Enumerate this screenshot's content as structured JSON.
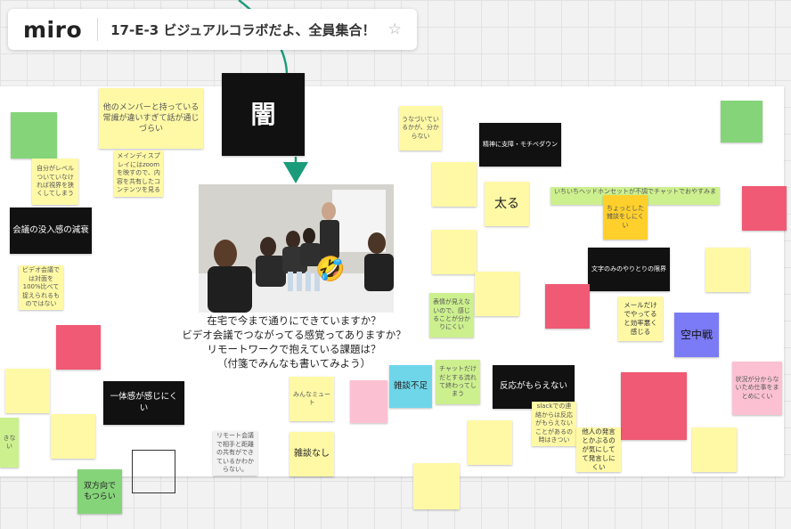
{
  "header": {
    "logo": "miro",
    "board_title": "17-E-3 ビジュアルコラボだよ、全員集合！",
    "star_icon": "☆"
  },
  "center": {
    "dark_label": "闇",
    "emoji": "🤣",
    "prompt_lines": [
      "在宅で今まで通りにできていますか？",
      "ビデオ会議でつながってる感覚ってありますか？",
      "リモートワークで抱えている課題は？",
      "（付箋でみんなも書いてみよう）"
    ]
  },
  "notes": {
    "members_pace": "他のメンバーと持っている常識が違いすぎて話が通じづらい",
    "own_level": "自分がレベルついていなければ視界を狭くしてしまう",
    "meeting_immersion": "会議の没入感の減衰",
    "media_display": "メインディスプレイにはzoomを映すので、内容を共有したコンテンツを見る",
    "video_participation": "ビデオ会議では対面を100%比べて捉えられるものではない",
    "nodding": "うなづいているかが、分からない",
    "spirit_motivation": "精神に支障・モチベダウン",
    "bold": "太る",
    "headset": "いちいちヘッドホンセットが不調でチャットでおやすみます",
    "small_talk_hard": "ちょっとした雑談をしにくい",
    "text_only_limit": "文字のみのやりとりの限界",
    "email_only": "メールだけでやってると効率悪く感じる",
    "aerial_battle": "空中戦",
    "expression_unclear": "表情が見えないので、感じることが分かりにくい",
    "solidarity": "一体感が感じにくい",
    "everyone_mute": "みんなミュート",
    "no_chat": "雑談不足",
    "chat_only": "チャットだけだとする流れて終わってしまう",
    "no_reaction": "反応がもらえない",
    "slack_reaction": "slackでの連絡からは反応がもらえないことがあるの時はきつい",
    "others_voice": "他人の発言とかぶるのが気にしてて発言しにくい",
    "no_small_talk": "雑談なし",
    "remote_meeting": "リモート会議で相手と距離の共有ができているかわからない。",
    "both_sides": "双方向でもつらい",
    "no_work_rhythm": "状況が分からないため仕事をまとめにくい",
    "thing": "きない"
  }
}
